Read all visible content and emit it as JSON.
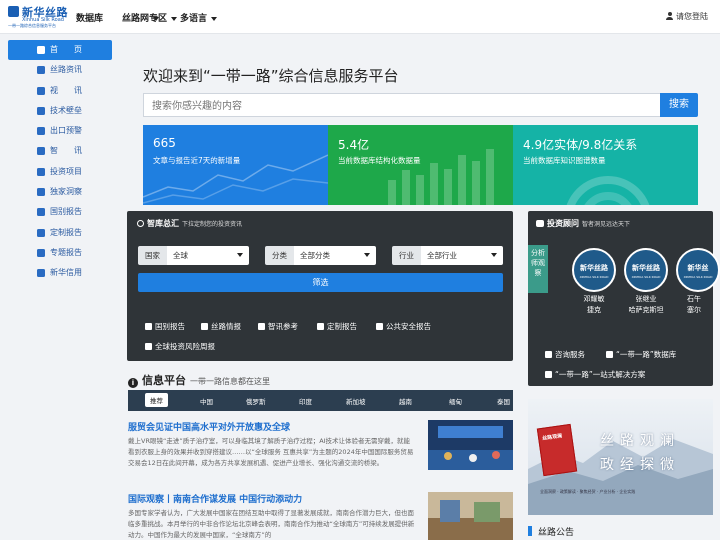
{
  "header": {
    "logo_cn": "新华丝路",
    "logo_en": "Xinhua Silk Road",
    "logo_sub": "一带一路综合信息服务平台",
    "nav": [
      {
        "label": "数据库",
        "dropdown": false
      },
      {
        "label": "丝路网",
        "dropdown": true
      },
      {
        "label": "专区",
        "dropdown": true
      },
      {
        "label": "多语言",
        "dropdown": true
      }
    ],
    "login": "请您登陆"
  },
  "sidebar": {
    "items": [
      {
        "label": "首　　页",
        "active": true
      },
      {
        "label": "丝路资讯"
      },
      {
        "label": "视　　讯"
      },
      {
        "label": "技术壁垒"
      },
      {
        "label": "出口预警"
      },
      {
        "label": "智　　讯"
      },
      {
        "label": "投资项目"
      },
      {
        "label": "独家洞察"
      },
      {
        "label": "国别报告"
      },
      {
        "label": "定制报告"
      },
      {
        "label": "专题报告"
      },
      {
        "label": "新华信用"
      }
    ]
  },
  "main": {
    "welcome": "欢迎来到“一带一路”综合信息服务平台",
    "search_placeholder": "搜索你感兴趣的内容",
    "search_button": "搜索",
    "stats": [
      {
        "number": "665",
        "desc": "文章与报告近7天的新增量",
        "color": "#1f7fe0"
      },
      {
        "number": "5.4亿",
        "desc": "当前数据库结构化数据量",
        "color": "#1ea84a"
      },
      {
        "number": "4.9亿实体/9.8亿关系",
        "desc": "当前数据库知识图谱数量",
        "color": "#15b3a6"
      }
    ]
  },
  "think_tank": {
    "title": "智库总汇",
    "subtitle": "下拉定制您的投资资讯",
    "filters": [
      {
        "label": "国家",
        "value": "全球"
      },
      {
        "label": "分类",
        "value": "全部分类"
      },
      {
        "label": "行业",
        "value": "全部行业"
      }
    ],
    "filter_button": "筛选",
    "links": [
      "国别报告",
      "丝路情报",
      "智讯参考",
      "定制报告",
      "公共安全报告",
      "全球投资风险周报"
    ]
  },
  "info": {
    "title": "信息平台",
    "subtitle": "一带一路信息都在这里",
    "tabs": [
      "推荐",
      "中国",
      "俄罗斯",
      "印度",
      "新加坡",
      "越南",
      "缅甸",
      "泰国"
    ],
    "news": [
      {
        "title": "服贸会见证中国高水平对外开放惠及全球",
        "body": "戴上VR眼镜“走进”质子治疗室，可以身临其境了解质子治疗过程；AI技术让体验者无需穿戴，就能看到衣服上身的效果并收到穿搭建议……以“全球服务 互惠共享”为主题的2024年中国国际服务贸易交易会12日在此间开幕，成为各方共享发展机遇、促进产业增长、强化沟通交流的桥梁。"
      },
      {
        "title": "国际观察丨南南合作谋发展 中国行动添动力",
        "body": "多国专家学者认为，广大发展中国家在团结互助中取得了显著发展成就，南南合作潜力巨大，但也面临多重挑战。本月举行的中非合作论坛北京峰会表明，南南合作为推动“全球南方”可持续发展提供新动力。中国作为最大的发展中国家，“全球南方”的"
      }
    ]
  },
  "consult": {
    "title": "投资顾问",
    "subtitle": "智者洞见远达天下",
    "vtab": "分析师观察",
    "experts": [
      {
        "badge": "新华丝路",
        "name1": "邓耀敏",
        "name2": "捷克"
      },
      {
        "badge": "新华丝路",
        "name1": "张继业",
        "name2": "哈萨克斯坦"
      },
      {
        "badge": "新华丝",
        "name1": "石午",
        "name2": "塞尔"
      }
    ],
    "badge_sub": "XINHUA SILK ROAD",
    "links": [
      "咨询服务",
      "“一带一路”数据库",
      "“一带一路”一站式解决方案"
    ]
  },
  "banner": {
    "title_line1": "丝路观澜",
    "title_line2": "政经探微",
    "book": "丝路观澜",
    "footer": "全面洞察 · 政策解读 · 聚焦经贸 · 产业分析 · 企业实践"
  },
  "announce": "丝路公告"
}
